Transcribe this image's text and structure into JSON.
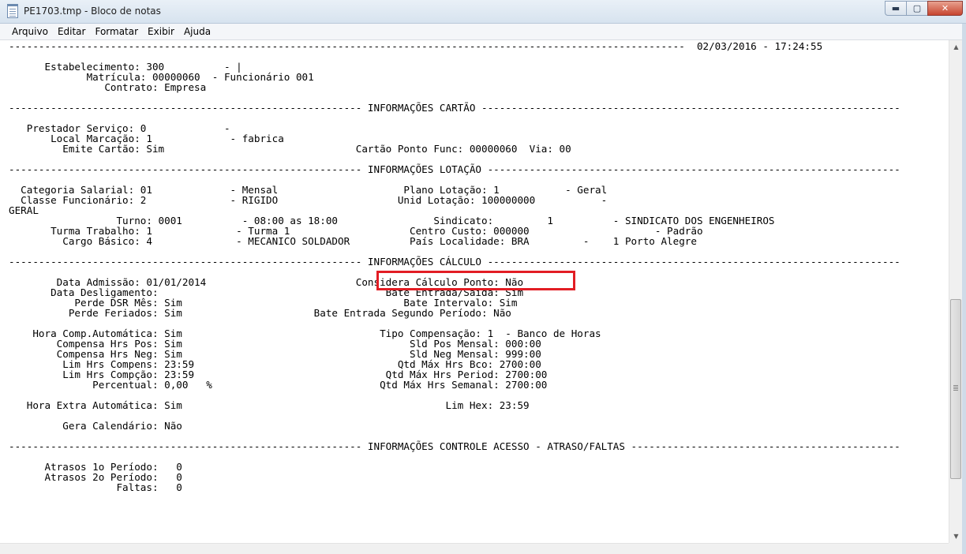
{
  "window": {
    "title": "PE1703.tmp - Bloco de notas",
    "minimize_icon": "minimize-icon",
    "maximize_icon": "maximize-icon",
    "close_icon": "close-icon",
    "minimize_glyph": "▬",
    "maximize_glyph": "▢",
    "close_glyph": "✕"
  },
  "menu": {
    "items": [
      "Arquivo",
      "Editar",
      "Formatar",
      "Exibir",
      "Ajuda"
    ]
  },
  "document": {
    "text": "-----------------------------------------------------------------------------------------------------------------  02/03/2016 - 17:24:55\n\n      Estabelecimento: 300          - |\n             Matrícula: 00000060  - Funcionário 001\n                Contrato: Empresa\n\n----------------------------------------------------------- INFORMAÇÕES CARTÃO ----------------------------------------------------------------------\n\n   Prestador Serviço: 0             -\n       Local Marcação: 1             - fabrica\n         Emite Cartão: Sim                                Cartão Ponto Func: 00000060  Via: 00\n\n----------------------------------------------------------- INFORMAÇÕES LOTAÇÃO ---------------------------------------------------------------------\n\n  Categoria Salarial: 01             - Mensal                     Plano Lotação: 1           - Geral\n  Classe Funcionário: 2              - RIGIDO                    Unid Lotação: 100000000           -\nGERAL\n                  Turno: 0001          - 08:00 as 18:00                Sindicato:         1          - SINDICATO DOS ENGENHEIROS\n       Turma Trabalho: 1              - Turma 1                    Centro Custo: 000000                     - Padrão\n         Cargo Básico: 4              - MECANICO SOLDADOR          País Localidade: BRA         -    1 Porto Alegre\n\n----------------------------------------------------------- INFORMAÇÕES CÁLCULO ---------------------------------------------------------------------\n\n        Data Admissão: 01/01/2014                         Considera Cálculo Ponto: Não\n       Data Desligamento:                                      Bate Entrada/Saída: Sim\n           Perde DSR Mês: Sim                                     Bate Intervalo: Sim\n          Perde Feriados: Sim                      Bate Entrada Segundo Período: Não\n\n    Hora Comp.Automática: Sim                                 Tipo Compensação: 1  - Banco de Horas\n        Compensa Hrs Pos: Sim                                      Sld Pos Mensal: 000:00\n        Compensa Hrs Neg: Sim                                      Sld Neg Mensal: 999:00\n         Lim Hrs Compens: 23:59                                  Qtd Máx Hrs Bco: 2700:00\n         Lim Hrs Compção: 23:59                                Qtd Máx Hrs Period: 2700:00\n              Percentual: 0,00   %                            Qtd Máx Hrs Semanal: 2700:00\n\n   Hora Extra Automática: Sim                                            Lim Hex: 23:59\n\n         Gera Calendário: Não\n\n----------------------------------------------------------- INFORMAÇÕES CONTROLE ACESSO - ATRASO/FALTAS ---------------------------------------------\n\n      Atrasos 1o Período:   0\n      Atrasos 2o Período:   0\n                  Faltas:   0"
  },
  "scrollbar": {
    "up_glyph": "▲",
    "down_glyph": "▼"
  },
  "colors": {
    "highlight": "#e21d24"
  }
}
